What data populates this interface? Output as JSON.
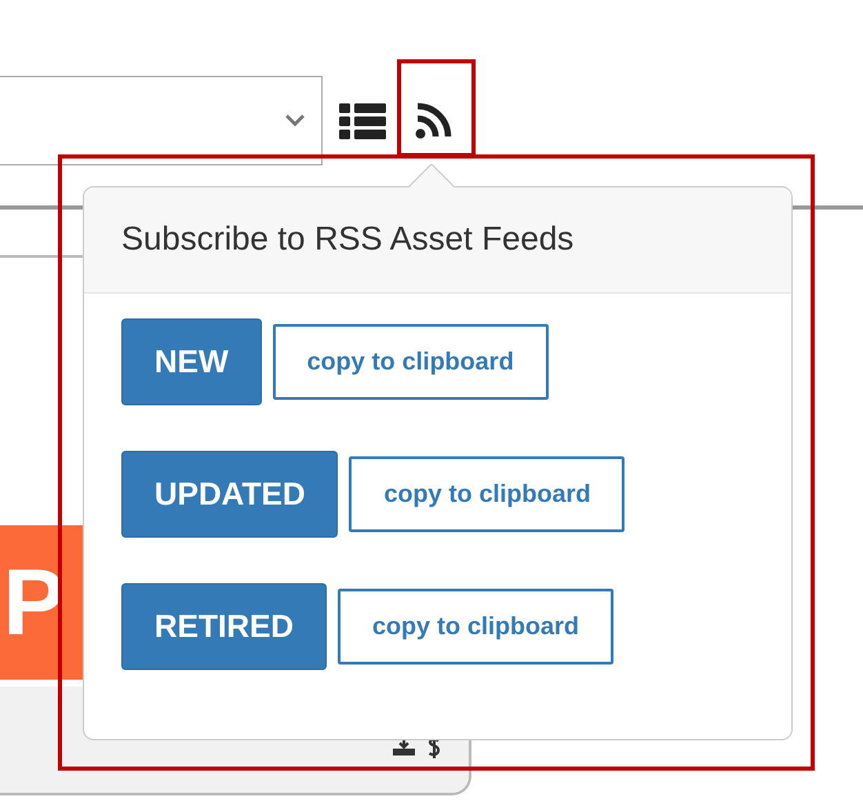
{
  "banner": {
    "text": "P"
  },
  "popover": {
    "title": "Subscribe to RSS Asset Feeds",
    "feeds": [
      {
        "label": "NEW",
        "copy": "copy to clipboard"
      },
      {
        "label": "UPDATED",
        "copy": "copy to clipboard"
      },
      {
        "label": "RETIRED",
        "copy": "copy to clipboard"
      }
    ]
  }
}
